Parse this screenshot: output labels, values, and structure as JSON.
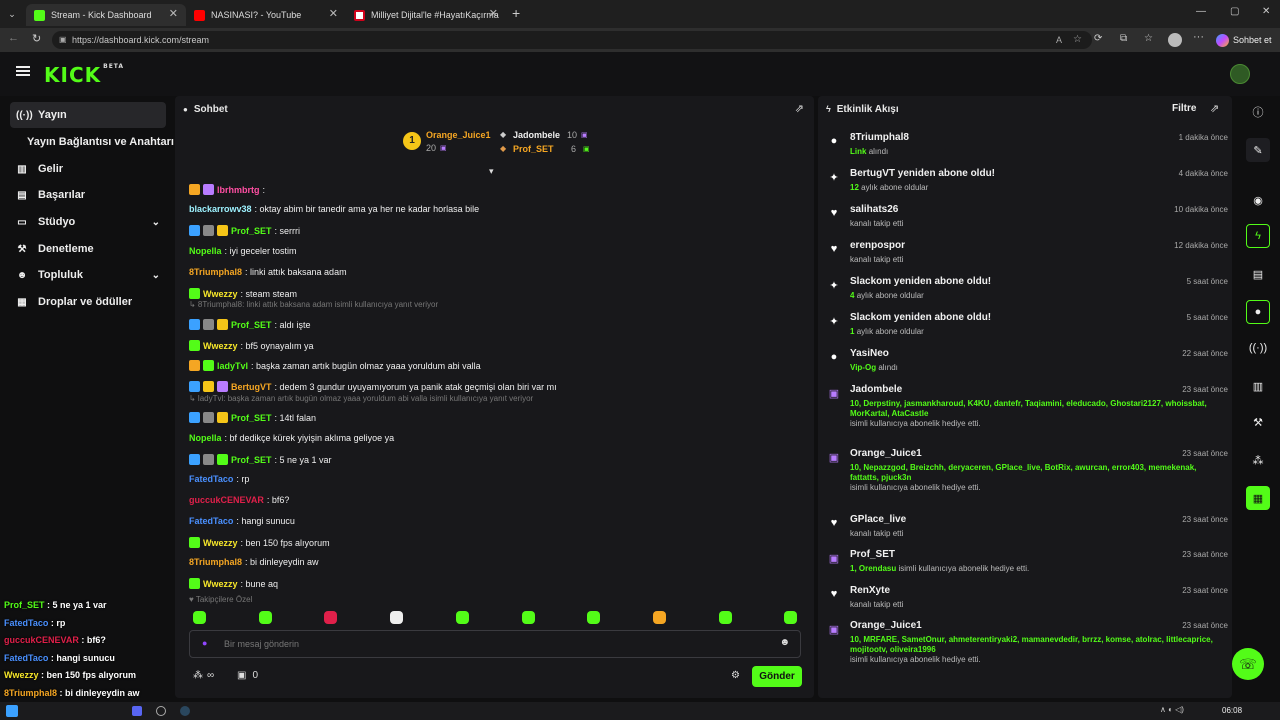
{
  "browser": {
    "tabs": [
      {
        "title": "Stream - Kick Dashboard",
        "color": "#53fc18"
      },
      {
        "title": "NASINASI? - YouTube",
        "color": "#ff0000"
      },
      {
        "title": "Milliyet Dijital'le #HayatıKaçırma",
        "color": "#d0021b"
      }
    ],
    "url": "https://dashboard.kick.com/stream",
    "copilot_label": "Sohbet et"
  },
  "logo": {
    "text": "KICK",
    "tag": "BETA"
  },
  "sidebar": {
    "items": [
      {
        "label": "Yayın",
        "icon": "broadcast-icon"
      },
      {
        "label": "Yayın Bağlantısı ve Anahtarı",
        "icon": ""
      },
      {
        "label": "Gelir",
        "icon": "revenue-icon"
      },
      {
        "label": "Başarılar",
        "icon": "achievements-icon"
      },
      {
        "label": "Stüdyo",
        "icon": "studio-icon"
      },
      {
        "label": "Denetleme",
        "icon": "moderation-icon"
      },
      {
        "label": "Topluluk",
        "icon": "community-icon"
      },
      {
        "label": "Droplar ve ödüller",
        "icon": "drops-icon"
      }
    ]
  },
  "chat": {
    "title": "Sohbet",
    "leaderboard": {
      "first_name": "Orange_Juice1",
      "first_count": "20",
      "first_rank": "1",
      "second_name": "Jadombele",
      "second_count": "10",
      "third_name": "Prof_SET",
      "third_count": "6"
    },
    "messages": [
      {
        "user": "lbrhmbrtg",
        "text": "",
        "color": "#ff4fa3"
      },
      {
        "user": "blackarrowv38",
        "text": "oktay abim bir tanedir ama ya her ne kadar horlasa bile",
        "color": "#9ef2ff"
      },
      {
        "user": "Prof_SET",
        "text": "serrri",
        "color": "#53fc18"
      },
      {
        "user": "Nopella",
        "text": "iyi geceler tostim",
        "color": "#53fc18"
      },
      {
        "user": "8Triumphal8",
        "text": "linki attık baksana adam",
        "color": "#f5a623"
      },
      {
        "user": "Wwezzy",
        "text": "steam steam",
        "color": "#f7e72a"
      },
      {
        "user": "Prof_SET",
        "text": "aldı işte",
        "color": "#53fc18"
      },
      {
        "user": "Wwezzy",
        "text": "bf5 oynayalım ya",
        "color": "#f7e72a"
      },
      {
        "user": "ladyTvl",
        "text": "başka zaman artık bugün olmaz yaaa yoruldum abi valla",
        "color": "#53fc18"
      },
      {
        "user": "BertugVT",
        "text": "dedem 3 gundur uyuyamıyorum ya panik atak geçmişi olan biri var mı",
        "color": "#f5a623"
      },
      {
        "user": "Prof_SET",
        "text": "14tl falan",
        "color": "#53fc18"
      },
      {
        "user": "Nopella",
        "text": "bf dedikçe kürek yiyişin aklıma geliyoe ya",
        "color": "#53fc18"
      },
      {
        "user": "Prof_SET",
        "text": "5 ne ya 1 var",
        "color": "#53fc18"
      },
      {
        "user": "FatedTaco",
        "text": "rp",
        "color": "#4a90ff"
      },
      {
        "user": "guccukCENEVAR",
        "text": "bf6?",
        "color": "#e0204a"
      },
      {
        "user": "FatedTaco",
        "text": "hangi sunucu",
        "color": "#4a90ff"
      },
      {
        "user": "Wwezzy",
        "text": "ben 150 fps alıyorum",
        "color": "#f7e72a"
      },
      {
        "user": "8Triumphal8",
        "text": "bi dinleyeydin aw",
        "color": "#f5a623"
      },
      {
        "user": "Wwezzy",
        "text": "bune aq",
        "color": "#f7e72a"
      }
    ],
    "replies": [
      "8Triumphal8: linki attık baksana adam isimli kullanıcıya yanıt veriyor",
      "ladyTvl: başka zaman artık bugün olmaz yaaa yoruldum abi valla isimli kullanıcıya yanıt veriyor"
    ],
    "follower_only": "Takipçilere Özel",
    "input_placeholder": "Bir mesaj gönderin",
    "viewers": "∞",
    "gift_count": "0",
    "send_label": "Gönder"
  },
  "activity": {
    "title": "Etkinlik Akışı",
    "filter_label": "Filtre",
    "events": [
      {
        "name": "8Triumphal8",
        "time": "1 dakika önce",
        "hl": "Link",
        "sub": "alındı",
        "icon": "reward-icon",
        "glyph": "●"
      },
      {
        "name": "BertugVT yeniden abone oldu!",
        "time": "4 dakika önce",
        "hl": "12",
        "sub": "aylık abone oldular",
        "icon": "sparkle-icon",
        "glyph": "✦"
      },
      {
        "name": "salihats26",
        "time": "10 dakika önce",
        "hl": "",
        "sub": "kanalı takip etti",
        "icon": "heart-icon",
        "glyph": "♥"
      },
      {
        "name": "erenpospor",
        "time": "12 dakika önce",
        "hl": "",
        "sub": "kanalı takip etti",
        "icon": "heart-icon",
        "glyph": "♥"
      },
      {
        "name": "Slackom yeniden abone oldu!",
        "time": "5 saat önce",
        "hl": "4",
        "sub": "aylık abone oldular",
        "icon": "sparkle-icon",
        "glyph": "✦"
      },
      {
        "name": "Slackom yeniden abone oldu!",
        "time": "5 saat önce",
        "hl": "1",
        "sub": "aylık abone oldular",
        "icon": "sparkle-icon",
        "glyph": "✦"
      },
      {
        "name": "YasiNeo",
        "time": "22 saat önce",
        "hl": "Vip-Og",
        "sub": "alındı",
        "icon": "reward-icon",
        "glyph": "●"
      },
      {
        "name": "Jadombele",
        "time": "23 saat önce",
        "hl": "10, Derpstiny, jasmankharoud, K4KU, dantefr, Taqiamini, eleducado, Ghostari2127, whoissbat, MorKartal, AtaCastle",
        "sub": "isimli kullanıcıya abonelik hediye etti.",
        "icon": "gift-icon",
        "glyph": "▣"
      },
      {
        "name": "Orange_Juice1",
        "time": "23 saat önce",
        "hl": "10, Nepazzgod, Breizchh, deryaceren, GPlace_live, BotRix, awurcan, error403, memekenak, fattatts, pjuck3n",
        "sub": "isimli kullanıcıya abonelik hediye etti.",
        "icon": "gift-icon",
        "glyph": "▣"
      },
      {
        "name": "GPlace_live",
        "time": "23 saat önce",
        "hl": "",
        "sub": "kanalı takip etti",
        "icon": "heart-icon",
        "glyph": "♥"
      },
      {
        "name": "Prof_SET",
        "time": "23 saat önce",
        "hl": "1, Orendasu",
        "sub": "isimli kullanıcıya abonelik hediye etti.",
        "icon": "gift-icon",
        "glyph": "▣"
      },
      {
        "name": "RenXyte",
        "time": "23 saat önce",
        "hl": "",
        "sub": "kanalı takip etti",
        "icon": "heart-icon",
        "glyph": "♥"
      },
      {
        "name": "Orange_Juice1",
        "time": "23 saat önce",
        "hl": "10, MRFARE, SametOnur, ahmeterentiryaki2, mamanevdedir, brrzz, komse, atolrac, littlecaprice, mojitootv, oliveira1996",
        "sub": "isimli kullanıcıya abonelik hediye etti.",
        "icon": "gift-icon",
        "glyph": "▣"
      }
    ]
  },
  "overlay": {
    "lines": [
      {
        "user": "Prof_SET",
        "text": "5 ne ya 1 var",
        "color": "#53fc18"
      },
      {
        "user": "FatedTaco",
        "text": "rp",
        "color": "#4a90ff"
      },
      {
        "user": "guccukCENEVAR",
        "text": "bf6?",
        "color": "#e0204a"
      },
      {
        "user": "FatedTaco",
        "text": "hangi sunucu",
        "color": "#4a90ff"
      },
      {
        "user": "Wwezzy",
        "text": "ben 150 fps alıyorum",
        "color": "#f7e72a"
      },
      {
        "user": "8Triumphal8",
        "text": "bi dinleyeydin aw",
        "color": "#f5a623"
      },
      {
        "user": "Wwezzy",
        "text": "bune aq",
        "color": "#f7e72a"
      }
    ]
  },
  "taskbar": {
    "clock": "06:08"
  },
  "colors": {
    "accent": "#53fc18",
    "panel": "#18181b",
    "bg": "#0f0f10"
  }
}
